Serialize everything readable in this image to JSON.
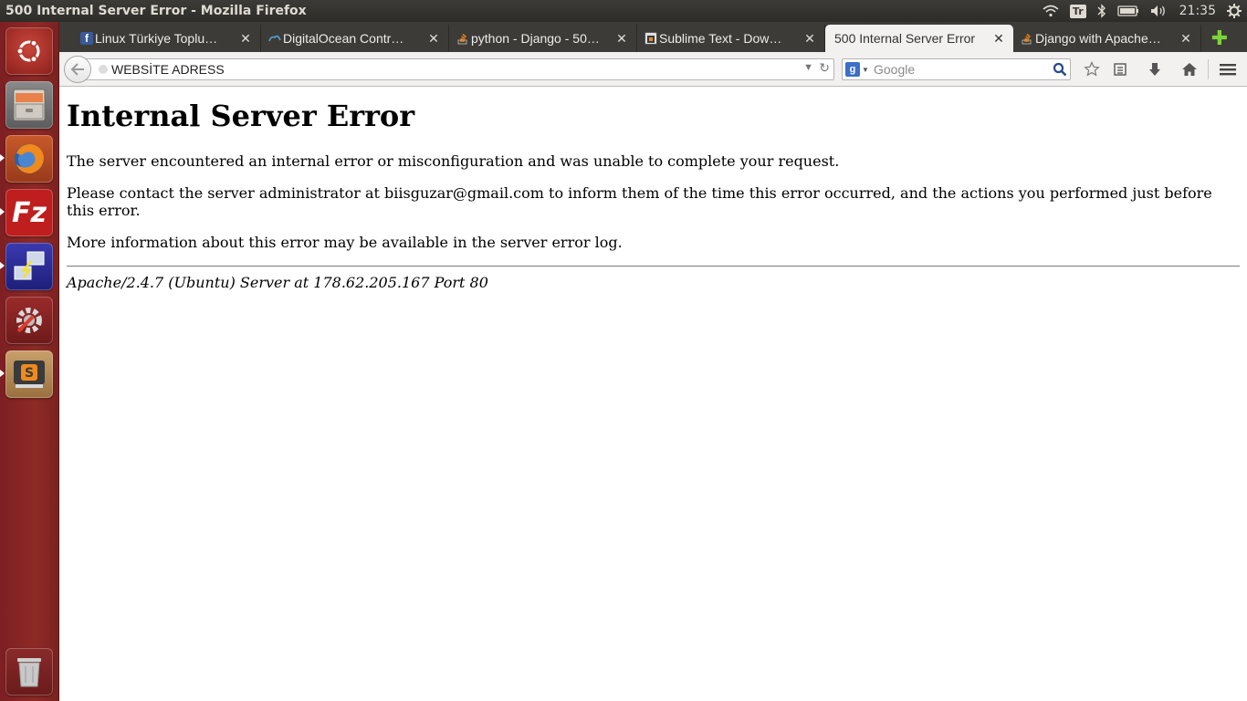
{
  "panel": {
    "window_title": "500 Internal Server Error - Mozilla Firefox",
    "keyboard_layout": "Tr",
    "clock": "21:35"
  },
  "launcher": {
    "items": [
      {
        "name": "ubuntu-dash-icon",
        "running": false
      },
      {
        "name": "files-icon",
        "running": false
      },
      {
        "name": "firefox-icon",
        "running": true
      },
      {
        "name": "filezilla-icon",
        "running": true
      },
      {
        "name": "network-tool-icon",
        "running": true
      },
      {
        "name": "system-settings-icon",
        "running": false
      },
      {
        "name": "sublime-text-icon",
        "running": true
      },
      {
        "name": "trash-icon",
        "running": false
      }
    ]
  },
  "tabs": [
    {
      "label": "Linux Türkiye Toplu…",
      "icon": "facebook-icon",
      "icon_color": "#3b5998",
      "active": false
    },
    {
      "label": "DigitalOcean Contr…",
      "icon": "digitalocean-icon",
      "icon_color": "#5aa0d8",
      "active": false
    },
    {
      "label": "python - Django - 50…",
      "icon": "stackoverflow-icon",
      "icon_color": "#e8821b",
      "active": false
    },
    {
      "label": "Sublime Text - Dow…",
      "icon": "sublime-icon",
      "icon_color": "#e0e0e0",
      "active": false
    },
    {
      "label": "500 Internal Server Error",
      "icon": "",
      "icon_color": "",
      "active": true
    },
    {
      "label": "Django with Apache…",
      "icon": "stackoverflow-icon",
      "icon_color": "#e8821b",
      "active": false
    }
  ],
  "navbar": {
    "url": "WEBSİTE ADRESS",
    "search_placeholder": "Google"
  },
  "page": {
    "heading": "Internal Server Error",
    "paragraph1": "The server encountered an internal error or misconfiguration and was unable to complete your request.",
    "paragraph2": "Please contact the server administrator at biisguzar@gmail.com to inform them of the time this error occurred, and the actions you performed just before this error.",
    "paragraph3": "More information about this error may be available in the server error log.",
    "server_signature": "Apache/2.4.7 (Ubuntu) Server at 178.62.205.167 Port 80"
  }
}
